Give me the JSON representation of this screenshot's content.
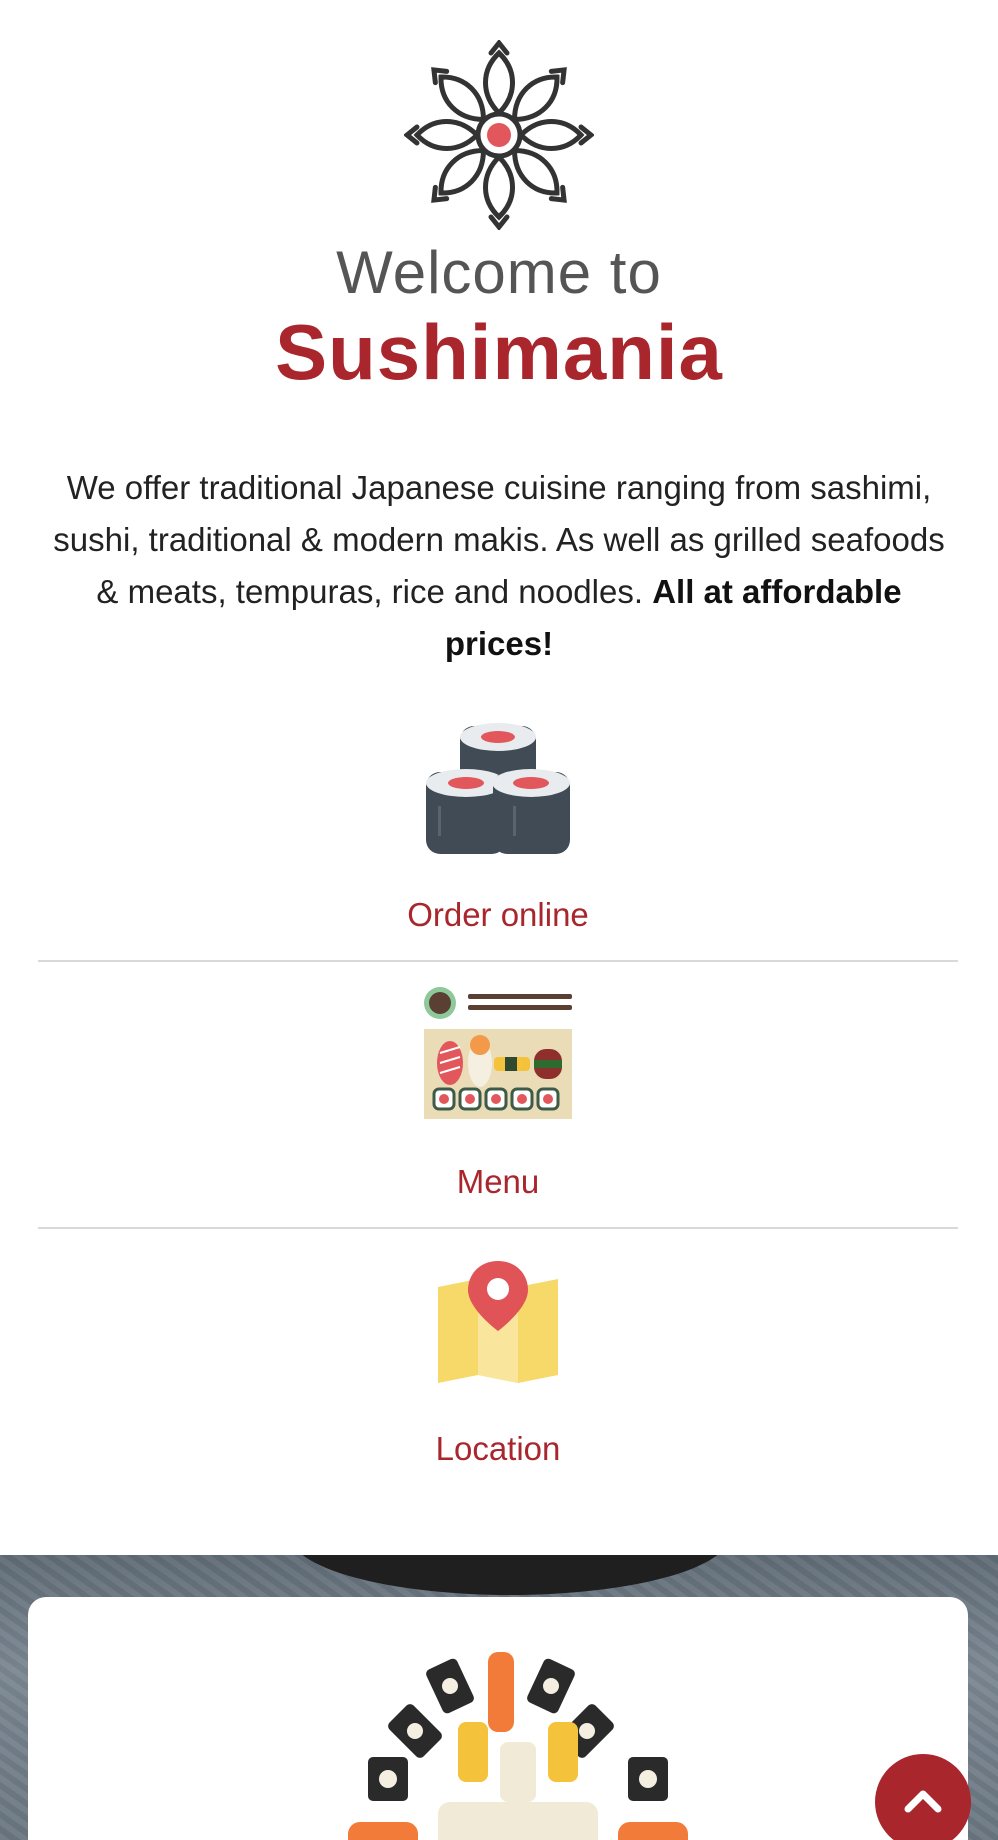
{
  "header": {
    "welcome": "Welcome to",
    "brand": "Sushimania",
    "logo_icon": "flower-sushi-icon"
  },
  "intro": {
    "text": "We offer traditional Japanese cuisine ranging from sashimi, sushi, traditional & modern makis. As well as grilled seafoods & meats, tempuras, rice and noodles.",
    "highlight": "All at affordable prices!"
  },
  "actions": [
    {
      "label": "Order online",
      "icon": "sushi-rolls-icon"
    },
    {
      "label": "Menu",
      "icon": "sushi-platter-icon"
    },
    {
      "label": "Location",
      "icon": "map-pin-icon"
    }
  ],
  "scroll_top": {
    "icon": "chevron-up-icon"
  },
  "colors": {
    "brand": "#a8262c",
    "text": "#222222",
    "divider": "#d9d9d9"
  }
}
